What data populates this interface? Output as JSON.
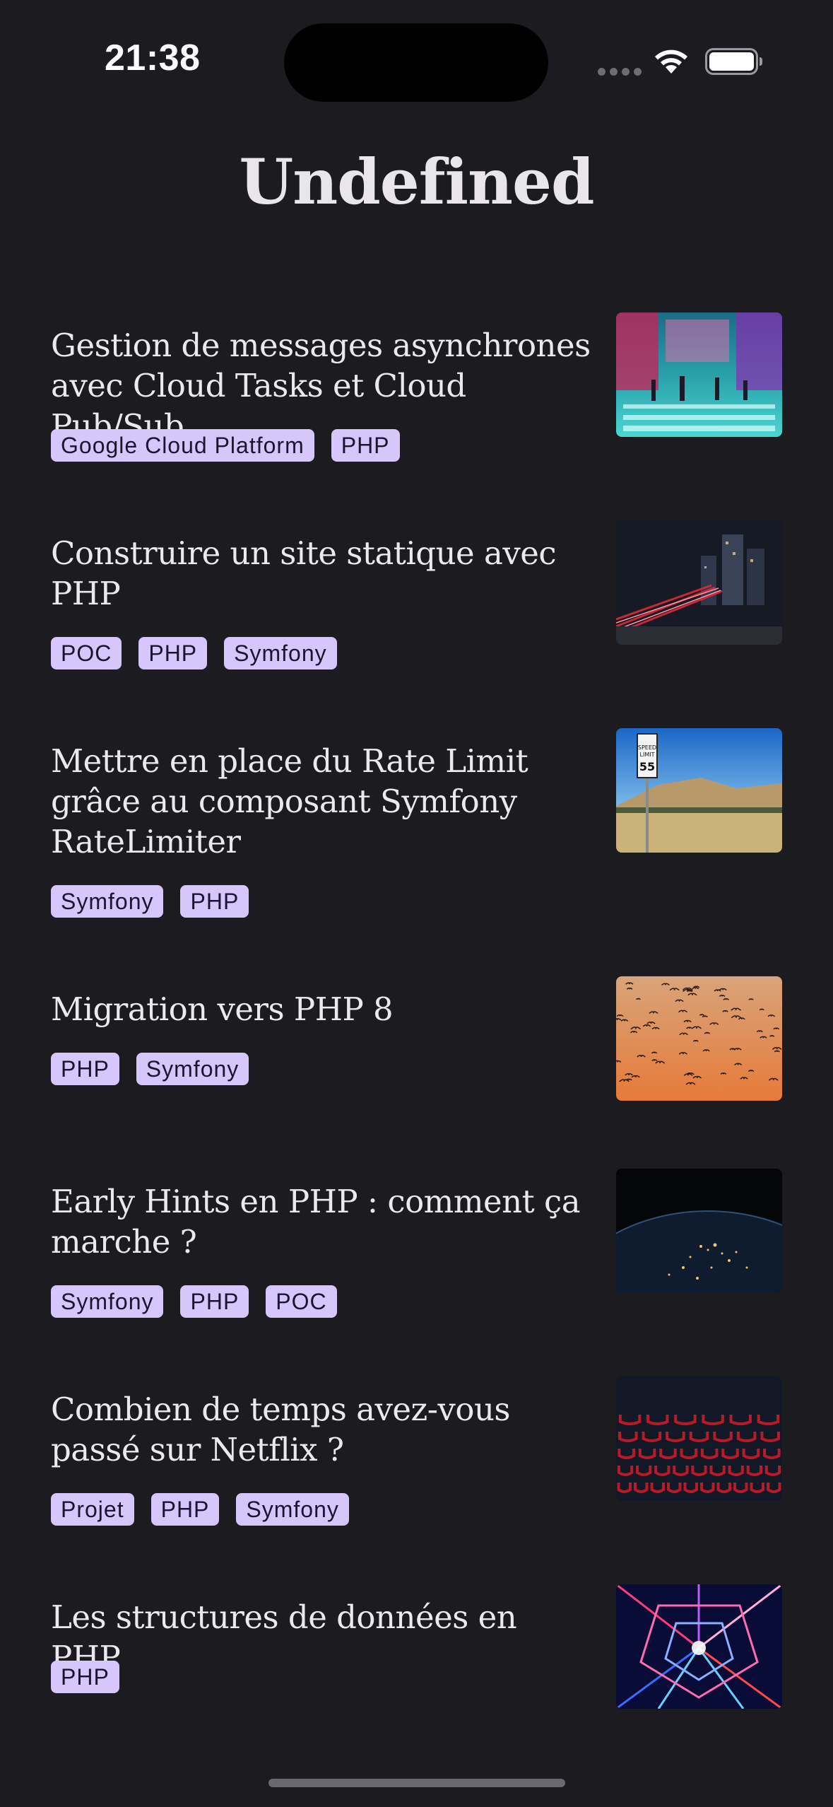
{
  "status_bar": {
    "time": "21:38"
  },
  "header": {
    "title": "Undefined"
  },
  "articles": [
    {
      "title": "Gestion de messages asynchrones avec Cloud Tasks et Cloud Pub/Sub",
      "tags": [
        "Google Cloud Platform",
        "PHP"
      ],
      "thumbnail": "city-crosswalk-neon-photo"
    },
    {
      "title": "Construire un site statique avec PHP",
      "tags": [
        "POC",
        "PHP",
        "Symfony"
      ],
      "thumbnail": "night-light-trails-photo"
    },
    {
      "title": "Mettre en place du Rate Limit grâce au composant Symfony RateLimiter",
      "tags": [
        "Symfony",
        "PHP"
      ],
      "thumbnail": "speed-limit-sign-photo"
    },
    {
      "title": "Migration vers PHP 8",
      "tags": [
        "PHP",
        "Symfony"
      ],
      "thumbnail": "birds-flock-sunset-photo"
    },
    {
      "title": "Early Hints en PHP : comment ça marche ?",
      "tags": [
        "Symfony",
        "PHP",
        "POC"
      ],
      "thumbnail": "earth-night-lights-photo"
    },
    {
      "title": "Combien de temps avez-vous passé sur Netflix ?",
      "tags": [
        "Projet",
        "PHP",
        "Symfony"
      ],
      "thumbnail": "cinema-red-seats-photo"
    },
    {
      "title": "Les structures de données en PHP",
      "tags": [
        "PHP"
      ],
      "thumbnail": "neon-geometric-structure-photo"
    }
  ],
  "colors": {
    "background": "#1c1b20",
    "tag_background": "#d7c6fb",
    "tag_text": "#1d1530",
    "text": "#ebe8ee"
  }
}
